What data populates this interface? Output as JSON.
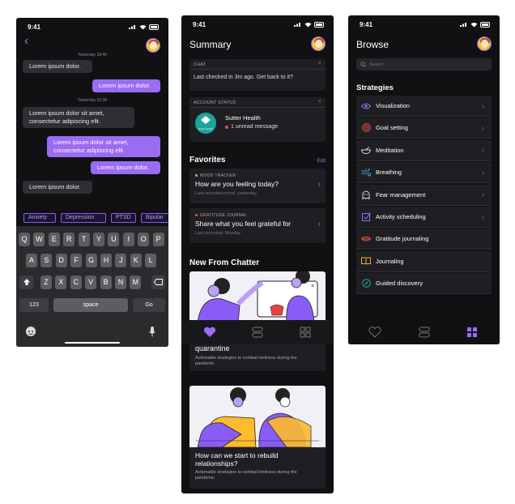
{
  "chat_screen": {
    "time": "9:41",
    "back_label": "‹",
    "messages": [
      {
        "kind": "time",
        "text": "Yesterday 18:45"
      },
      {
        "kind": "in",
        "text": "Lorem ipsum dolor."
      },
      {
        "kind": "out",
        "text": "Lorem ipsum dolor."
      },
      {
        "kind": "time",
        "text": "Yesterday 20:38"
      },
      {
        "kind": "in",
        "text": "Lorem ipsum dolor sit amet, consectetur adipiscing elit."
      },
      {
        "kind": "out",
        "text": "Lorem ipsum dolor sit amet, consectetur adipiscing elit."
      },
      {
        "kind": "out",
        "text": "Lorem ipsum dolor."
      },
      {
        "kind": "in",
        "text": "Lorem ipsum dolor."
      }
    ],
    "chips": [
      "Anxiety",
      "Depression",
      "PTSD",
      "Bipolar"
    ],
    "keyboard": {
      "row1": [
        "Q",
        "W",
        "E",
        "R",
        "T",
        "Y",
        "U",
        "I",
        "O",
        "P"
      ],
      "row2": [
        "A",
        "S",
        "D",
        "F",
        "G",
        "H",
        "J",
        "K",
        "L"
      ],
      "row3": [
        "Z",
        "X",
        "C",
        "V",
        "B",
        "N",
        "M"
      ],
      "numbers": "123",
      "space": "space",
      "go": "Go"
    }
  },
  "summary_screen": {
    "time": "9:41",
    "title": "Summary",
    "chat_card": {
      "header": "CHAT",
      "text": "Last checked in 3m ago. Get back to it?"
    },
    "account_card": {
      "header": "ACCOUNT STATUS",
      "org": "Sutter Health",
      "logo_text": "Sutter Health",
      "unread": "1 unread message"
    },
    "favorites_title": "Favorites",
    "edit_label": "Edit",
    "favorites": [
      {
        "tag": "MOOD TRACKER",
        "question": "How are you feeling today?",
        "sub": "Last recorded mood: yesterday",
        "color": "#f0a43a"
      },
      {
        "tag": "GRATITUDE JOURNAL",
        "question": "Share what you feel grateful for",
        "sub": "Last recorded: Monday",
        "color": "#e0503e"
      }
    ],
    "new_title": "New From Chatter",
    "articles": [
      {
        "title": "quarantine",
        "desc": "Actionable strategies to combat lonliness during the pandemic"
      },
      {
        "title": "How can we start to rebuild relationships?",
        "desc": "Actionable strategies to combat lonliness during the pandemic"
      }
    ]
  },
  "browse_screen": {
    "time": "9:41",
    "title": "Browse",
    "search_placeholder": "Search",
    "strategies_title": "Strategies",
    "items": [
      {
        "label": "Visualization",
        "icon": "eye-icon",
        "chev": "›"
      },
      {
        "label": "Goal setting",
        "icon": "target-icon",
        "chev": "›"
      },
      {
        "label": "Meditation",
        "icon": "bowl-icon",
        "chev": "›"
      },
      {
        "label": "Breathing",
        "icon": "wind-icon",
        "chev": "›"
      },
      {
        "label": "Fear management",
        "icon": "ghost-icon",
        "chev": "›"
      },
      {
        "label": "Activity scheduling",
        "icon": "checkbox-icon",
        "chev": "›"
      },
      {
        "label": "Gratitude journaling",
        "icon": "lips-icon",
        "chev": ""
      },
      {
        "label": "Journaling",
        "icon": "book-icon",
        "chev": ""
      },
      {
        "label": "Guided discovery",
        "icon": "compass-icon",
        "chev": ""
      }
    ]
  },
  "colors": {
    "accent": "#9a6cf2",
    "bg": "#111114",
    "card": "#1f1f23"
  }
}
